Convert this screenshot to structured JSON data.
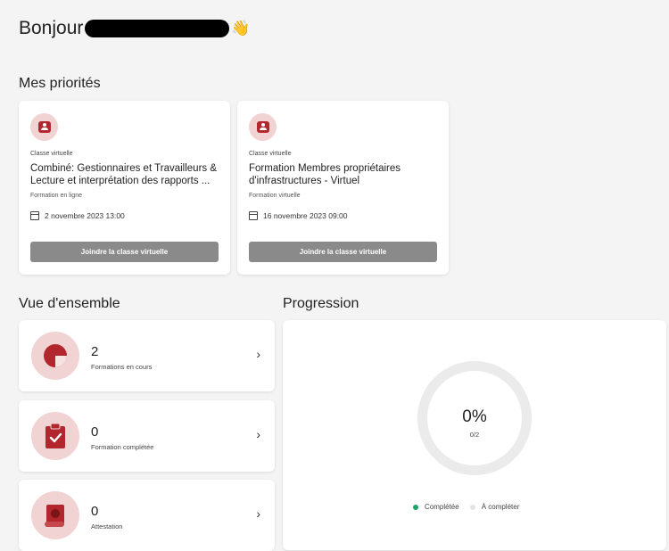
{
  "header": {
    "greeting": "Bonjour",
    "wave_emoji": "👋"
  },
  "priorities": {
    "title": "Mes priorités",
    "cards": [
      {
        "type": "Classe virtuelle",
        "title": "Combiné: Gestionnaires et Travailleurs & Lecture et interprétation des rapports ...",
        "subtitle": "Formation en ligne",
        "date": "2 novembre 2023 13:00",
        "button": "Joindre la classe virtuelle"
      },
      {
        "type": "Classe virtuelle",
        "title": "Formation Membres propriétaires d'infrastructures - Virtuel",
        "subtitle": "Formation virtuelle",
        "date": "16 novembre 2023 09:00",
        "button": "Joindre la classe virtuelle"
      }
    ]
  },
  "overview": {
    "title": "Vue d'ensemble",
    "items": [
      {
        "value": "2",
        "label": "Formations en cours",
        "icon": "pie-chart-icon"
      },
      {
        "value": "0",
        "label": "Formation complétée",
        "icon": "clipboard-check-icon"
      },
      {
        "value": "0",
        "label": "Attestation",
        "icon": "certificate-scroll-icon"
      }
    ]
  },
  "progress": {
    "title": "Progression",
    "percent": "0%",
    "fraction": "0/2",
    "completed_ratio": 0,
    "legend": [
      {
        "label": "Complétée",
        "color": "#1aa56b"
      },
      {
        "label": "À compléter",
        "color": "#e3e3e3"
      }
    ]
  },
  "colors": {
    "accent": "#b1272d",
    "accent_light": "#f2d3d3",
    "button_gray": "#8a8a8a"
  }
}
